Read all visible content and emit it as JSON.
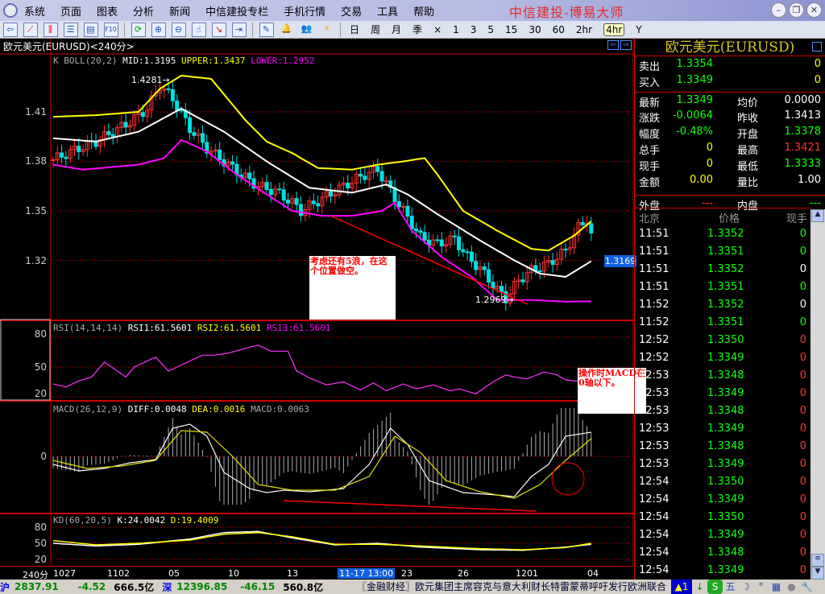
{
  "menu": {
    "items": [
      "系统",
      "页面",
      "图表",
      "分析",
      "新闻",
      "中信建投专栏",
      "手机行情",
      "交易",
      "工具",
      "帮助"
    ],
    "brand": "中信建投-博易大师"
  },
  "toolbar": {
    "periods": [
      "日",
      "周",
      "月",
      "季",
      "×",
      "1",
      "3",
      "5",
      "15",
      "30",
      "60",
      "2hr",
      "4hr",
      "Y"
    ],
    "active": "4hr"
  },
  "chart": {
    "title": "欧元美元(EURUSD)<240分>",
    "boll": {
      "name": "K  BOLL(20,2)",
      "mid": "MID:1.3195",
      "upper": "UPPER:1.3437",
      "lower": "LOWER:1.2952"
    },
    "rsi": {
      "name": "RSI(14,14,14)",
      "rsi1": "RSI1:61.5601",
      "rsi2": "RSI2:61.5601",
      "rsi3": "RSI3:61.5601"
    },
    "macd": {
      "name": "MACD(26,12,9)",
      "diff": "DIFF:0.0048",
      "dea": "DEA:0.0016",
      "macd": "MACD:0.0063"
    },
    "kd": {
      "name": "KD(60,20,5)",
      "k": "K:24.0042",
      "d": "D:19.4009"
    },
    "price_ticks": [
      "1.41",
      "1.38",
      "1.35",
      "1.32"
    ],
    "rsi_ticks": [
      "80",
      "50",
      "20"
    ],
    "macd_ticks": [
      "0"
    ],
    "kd_ticks": [
      "80",
      "50",
      "20"
    ],
    "high_label": "1.4281→",
    "low_label": "1.2969→",
    "last_price_tag": "1.3169",
    "x_axis": {
      "period": "240分",
      "labels": [
        "1027",
        "1102",
        "05",
        "10",
        "13",
        "11-17 13:00",
        "23",
        "26",
        "1201",
        "04"
      ]
    },
    "note1": "考虑还有5浪，在这个位置做空。",
    "note2": "操作时MACD在0轴以下。"
  },
  "chart_data": {
    "type": "line",
    "close": [
      [
        0,
        1.381
      ],
      [
        6,
        1.388
      ],
      [
        10,
        1.392
      ],
      [
        14,
        1.398
      ],
      [
        18,
        1.404
      ],
      [
        22,
        1.412
      ],
      [
        25,
        1.426
      ],
      [
        28,
        1.418
      ],
      [
        32,
        1.4
      ],
      [
        36,
        1.388
      ],
      [
        40,
        1.38
      ],
      [
        44,
        1.372
      ],
      [
        48,
        1.365
      ],
      [
        52,
        1.362
      ],
      [
        56,
        1.355
      ],
      [
        58,
        1.35
      ],
      [
        62,
        1.356
      ],
      [
        66,
        1.362
      ],
      [
        70,
        1.368
      ],
      [
        73,
        1.372
      ],
      [
        76,
        1.375
      ],
      [
        79,
        1.362
      ],
      [
        82,
        1.35
      ],
      [
        86,
        1.334
      ],
      [
        90,
        1.33
      ],
      [
        94,
        1.333
      ],
      [
        97,
        1.322
      ],
      [
        100,
        1.315
      ],
      [
        104,
        1.302
      ],
      [
        106,
        1.297
      ],
      [
        109,
        1.308
      ],
      [
        112,
        1.314
      ],
      [
        116,
        1.318
      ],
      [
        120,
        1.326
      ],
      [
        123,
        1.34
      ],
      [
        125,
        1.345
      ],
      [
        126,
        1.3349
      ]
    ],
    "mid": [
      [
        0,
        1.394
      ],
      [
        10,
        1.392
      ],
      [
        20,
        1.398
      ],
      [
        30,
        1.412
      ],
      [
        40,
        1.398
      ],
      [
        50,
        1.38
      ],
      [
        60,
        1.364
      ],
      [
        70,
        1.361
      ],
      [
        78,
        1.366
      ],
      [
        83,
        1.36
      ],
      [
        90,
        1.348
      ],
      [
        100,
        1.332
      ],
      [
        108,
        1.32
      ],
      [
        114,
        1.312
      ],
      [
        120,
        1.31
      ],
      [
        126,
        1.3195
      ]
    ],
    "upper": [
      [
        0,
        1.407
      ],
      [
        10,
        1.408
      ],
      [
        20,
        1.41
      ],
      [
        25,
        1.424
      ],
      [
        30,
        1.432
      ],
      [
        37,
        1.43
      ],
      [
        45,
        1.405
      ],
      [
        50,
        1.392
      ],
      [
        56,
        1.385
      ],
      [
        62,
        1.376
      ],
      [
        70,
        1.375
      ],
      [
        76,
        1.378
      ],
      [
        82,
        1.38
      ],
      [
        87,
        1.382
      ],
      [
        90,
        1.372
      ],
      [
        96,
        1.35
      ],
      [
        104,
        1.338
      ],
      [
        112,
        1.327
      ],
      [
        116,
        1.326
      ],
      [
        122,
        1.335
      ],
      [
        126,
        1.3437
      ]
    ],
    "lower": [
      [
        0,
        1.378
      ],
      [
        7,
        1.375
      ],
      [
        20,
        1.378
      ],
      [
        26,
        1.382
      ],
      [
        30,
        1.393
      ],
      [
        36,
        1.386
      ],
      [
        43,
        1.372
      ],
      [
        50,
        1.36
      ],
      [
        56,
        1.35
      ],
      [
        63,
        1.347
      ],
      [
        70,
        1.347
      ],
      [
        77,
        1.35
      ],
      [
        80,
        1.355
      ],
      [
        84,
        1.338
      ],
      [
        91,
        1.322
      ],
      [
        98,
        1.31
      ],
      [
        104,
        1.296
      ],
      [
        112,
        1.296
      ],
      [
        120,
        1.295
      ],
      [
        126,
        1.2952
      ]
    ],
    "rsi": [
      [
        0,
        33
      ],
      [
        3,
        30
      ],
      [
        6,
        36
      ],
      [
        9,
        40
      ],
      [
        12,
        55
      ],
      [
        15,
        46
      ],
      [
        17,
        40
      ],
      [
        19,
        50
      ],
      [
        24,
        60
      ],
      [
        27,
        46
      ],
      [
        30,
        52
      ],
      [
        35,
        62
      ],
      [
        38,
        62
      ],
      [
        41,
        64
      ],
      [
        46,
        70
      ],
      [
        48,
        72
      ],
      [
        51,
        66
      ],
      [
        55,
        66
      ],
      [
        57,
        46
      ],
      [
        60,
        39
      ],
      [
        64,
        32
      ],
      [
        68,
        35
      ],
      [
        72,
        27
      ],
      [
        75,
        34
      ],
      [
        78,
        26
      ],
      [
        82,
        33
      ],
      [
        85,
        28
      ],
      [
        89,
        32
      ],
      [
        93,
        26
      ],
      [
        95,
        28
      ],
      [
        99,
        23
      ],
      [
        103,
        35
      ],
      [
        106,
        42
      ],
      [
        108,
        40
      ],
      [
        111,
        38
      ],
      [
        115,
        45
      ],
      [
        118,
        42
      ],
      [
        120,
        37
      ],
      [
        124,
        35
      ],
      [
        126,
        36
      ]
    ],
    "macd_diff": [
      [
        0,
        -10
      ],
      [
        6,
        -18
      ],
      [
        12,
        -15
      ],
      [
        18,
        -8
      ],
      [
        24,
        -4
      ],
      [
        28,
        35
      ],
      [
        32,
        40
      ],
      [
        36,
        25
      ],
      [
        40,
        -20
      ],
      [
        46,
        -40
      ],
      [
        50,
        -45
      ],
      [
        54,
        -42
      ],
      [
        60,
        -44
      ],
      [
        68,
        -40
      ],
      [
        74,
        -10
      ],
      [
        79,
        35
      ],
      [
        83,
        15
      ],
      [
        88,
        -30
      ],
      [
        96,
        -45
      ],
      [
        104,
        -48
      ],
      [
        108,
        -50
      ],
      [
        112,
        -25
      ],
      [
        116,
        -10
      ],
      [
        120,
        25
      ],
      [
        126,
        30
      ]
    ],
    "macd_dea": [
      [
        0,
        -5
      ],
      [
        8,
        -15
      ],
      [
        16,
        -12
      ],
      [
        24,
        -5
      ],
      [
        30,
        32
      ],
      [
        36,
        30
      ],
      [
        42,
        0
      ],
      [
        48,
        -35
      ],
      [
        56,
        -42
      ],
      [
        66,
        -42
      ],
      [
        74,
        -25
      ],
      [
        80,
        25
      ],
      [
        86,
        5
      ],
      [
        92,
        -30
      ],
      [
        100,
        -44
      ],
      [
        108,
        -52
      ],
      [
        114,
        -35
      ],
      [
        120,
        -5
      ],
      [
        126,
        22
      ]
    ],
    "kd_k": [
      [
        0,
        50
      ],
      [
        10,
        45
      ],
      [
        20,
        48
      ],
      [
        32,
        58
      ],
      [
        40,
        70
      ],
      [
        48,
        72
      ],
      [
        56,
        60
      ],
      [
        66,
        47
      ],
      [
        76,
        50
      ],
      [
        86,
        43
      ],
      [
        100,
        38
      ],
      [
        110,
        37
      ],
      [
        120,
        43
      ],
      [
        126,
        48
      ]
    ],
    "kd_d": [
      [
        0,
        55
      ],
      [
        10,
        47
      ],
      [
        20,
        50
      ],
      [
        32,
        56
      ],
      [
        40,
        67
      ],
      [
        48,
        70
      ],
      [
        56,
        62
      ],
      [
        66,
        48
      ],
      [
        76,
        48
      ],
      [
        86,
        45
      ],
      [
        100,
        40
      ],
      [
        110,
        38
      ],
      [
        120,
        42
      ],
      [
        126,
        50
      ]
    ],
    "price_range": [
      1.284,
      1.4446
    ]
  },
  "quote": {
    "title": "欧元美元(EURUSD)",
    "rows": [
      {
        "l1": "卖出",
        "v1": "1.3354",
        "c1": "g",
        "l2": "",
        "v2": "0",
        "c2": "y"
      },
      {
        "l1": "买入",
        "v1": "1.3349",
        "c1": "g",
        "l2": "",
        "v2": "0",
        "c2": "y"
      },
      {
        "l1": "最新",
        "v1": "1.3349",
        "c1": "g",
        "l2": "均价",
        "v2": "0.0000",
        "c2": "w"
      },
      {
        "l1": "涨跌",
        "v1": "-0.0064",
        "c1": "g",
        "l2": "昨收",
        "v2": "1.3413",
        "c2": "w"
      },
      {
        "l1": "幅度",
        "v1": "-0.48%",
        "c1": "g",
        "l2": "开盘",
        "v2": "1.3378",
        "c2": "g"
      },
      {
        "l1": "总手",
        "v1": "0",
        "c1": "y",
        "l2": "最高",
        "v2": "1.3421",
        "c2": "r"
      },
      {
        "l1": "现手",
        "v1": "0",
        "c1": "y",
        "l2": "最低",
        "v2": "1.3333",
        "c2": "g"
      },
      {
        "l1": "金额",
        "v1": "0.00",
        "c1": "y",
        "l2": "量比",
        "v2": "1.00",
        "c2": "w"
      },
      {
        "l1": "外盘",
        "v1": "---",
        "c1": "r",
        "l2": "内盘",
        "v2": "---",
        "c2": "g"
      }
    ],
    "tick_headers": [
      "北京",
      "价格",
      "现手"
    ],
    "ticks": [
      [
        "11:51",
        "1.3352",
        "0",
        "g"
      ],
      [
        "11:51",
        "1.3351",
        "0",
        "g"
      ],
      [
        "11:51",
        "1.3352",
        "0",
        "w"
      ],
      [
        "11:51",
        "1.3351",
        "0",
        "g"
      ],
      [
        "11:52",
        "1.3352",
        "0",
        "w"
      ],
      [
        "11:52",
        "1.3351",
        "0",
        "g"
      ],
      [
        "12:52",
        "1.3350",
        "0",
        "r"
      ],
      [
        "12:52",
        "1.3349",
        "0",
        "r"
      ],
      [
        "12:53",
        "1.3348",
        "0",
        "r"
      ],
      [
        "12:53",
        "1.3349",
        "0",
        "r"
      ],
      [
        "12:53",
        "1.3348",
        "0",
        "r"
      ],
      [
        "12:53",
        "1.3349",
        "0",
        "r"
      ],
      [
        "12:53",
        "1.3348",
        "0",
        "r"
      ],
      [
        "12:53",
        "1.3349",
        "0",
        "r"
      ],
      [
        "12:54",
        "1.3350",
        "0",
        "r"
      ],
      [
        "12:54",
        "1.3349",
        "0",
        "r"
      ],
      [
        "12:54",
        "1.3350",
        "0",
        "r"
      ],
      [
        "12:54",
        "1.3349",
        "0",
        "r"
      ],
      [
        "12:54",
        "1.3348",
        "0",
        "r"
      ],
      [
        "12:54",
        "1.3349",
        "0",
        "r"
      ]
    ]
  },
  "status": {
    "sh_label": "沪",
    "sh_index": "2837.91",
    "sh_change": "-4.52",
    "sh_amount": "666.5亿",
    "sz_label": "深",
    "sz_index": "12396.85",
    "sz_change": "-46.15",
    "sz_amount": "560.8亿",
    "news": "〖金融财经〗欧元集团主席容克与意大利财长特雷蒙蒂呼吁发行欧洲联合主权债券",
    "alert": "▲1"
  }
}
